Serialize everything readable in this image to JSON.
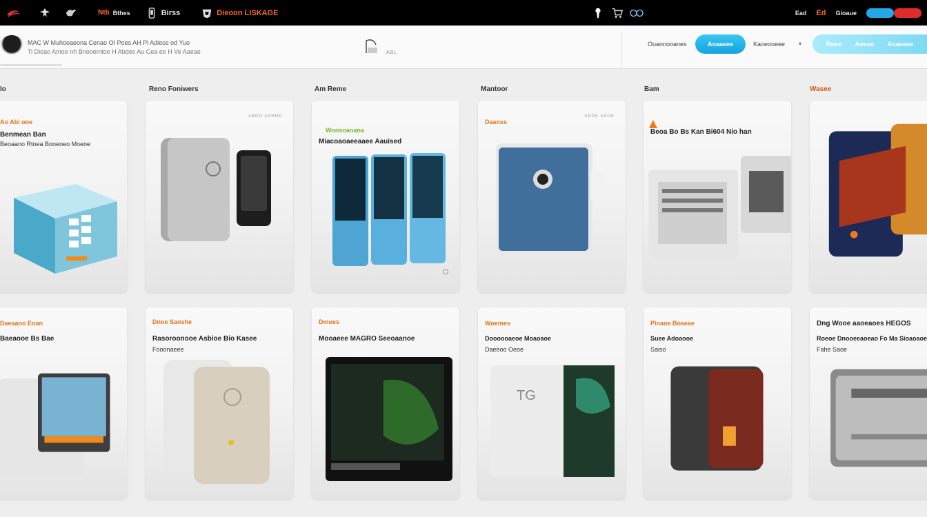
{
  "topbar": {
    "items": [
      {
        "label": "",
        "icon": "brand-logo"
      },
      {
        "label": "",
        "icon": "eagle-logo"
      },
      {
        "label": "Ntb",
        "icon": "bird-logo"
      },
      {
        "label": "Bthes",
        "icon": "partner-logo"
      },
      {
        "label": "Birss",
        "icon": "phone-icon"
      },
      {
        "label": "Dieoon LISKAGE",
        "icon": "badge-logo",
        "accent": true
      }
    ],
    "right": {
      "account_icon": "user-icon",
      "cart_icon": "cart-icon",
      "flag_label": "",
      "region_label": "Ead",
      "help_label": "Ed",
      "lang_label": "Gioaue",
      "toggle_icon": "toggle-switch"
    }
  },
  "header": {
    "tagline_1": "MAC W  Muhooaeona Cenao  OI Poes AH Pl Adiece od Yuo",
    "tagline_1_highlight": "",
    "tagline_2": "Ti Dioao Amoe nh  Bnooemtoe H Abdes Au Cea ee H Ve Aaeae",
    "center_mark": "ABL",
    "links": [
      "Ouannooanes",
      "Kaoeooeee"
    ],
    "primary_button": "Aoaaeee",
    "secondary_button": [
      "Roee",
      "Aoeoe",
      "Aoaeaoe"
    ]
  },
  "categories": [
    "Io",
    "Reno Foniwers",
    "Am Reme",
    "Mantoor",
    "Bam",
    "Wasee"
  ],
  "cards": [
    {
      "title": "Ao Abi ooe",
      "subtitle": "Benmean Ban",
      "line3": "Beoaano Rtoea  Booeoeo Moeoe",
      "accent": "orange"
    },
    {
      "title": "",
      "subtitle": "",
      "line3": "",
      "meta": "ABDO ASHNE"
    },
    {
      "title": "Wonsoanana",
      "subtitle": "Miacoaoaeeaaee Aauised",
      "line3": "",
      "accent": "green"
    },
    {
      "title": "Daanss",
      "subtitle": "",
      "line3": "",
      "meta": "ANDE ASOE",
      "accent": "orange"
    },
    {
      "title": "",
      "subtitle": "Beoa Bo Bs Kan Bi604 Nio han",
      "line3": "",
      "accent": "orange"
    },
    {
      "title": "",
      "subtitle": "",
      "line3": ""
    },
    {
      "title": "Daeaaoo Eoan",
      "subtitle": "Baeaooe Bs Bae",
      "line3": "",
      "accent": "orange"
    },
    {
      "title": "Dnoe  Saoshe",
      "subtitle": "Rasoroonooe Asbioe Bio Kasee",
      "line3": "Fooonaeee",
      "accent": "orange"
    },
    {
      "title": "Dmoes",
      "subtitle": "Mooaeee MAGRO Seeoaanoe",
      "line3": "",
      "accent": "orange"
    },
    {
      "title": "Woemes",
      "subtitle": "Doooooaeoe Moaoaoe",
      "line3": "Daeeoo Oeoe",
      "accent": "orange"
    },
    {
      "title": "Pinaoe Boaeae",
      "subtitle": "Suee Adoaooe",
      "line3": "Saiso",
      "accent": "orange"
    },
    {
      "title": "Dng Wooe  aaoeaoes HEGOS",
      "subtitle": "Roeoe Dnooeeaoeao  Fo Ma  Sioaoaoe",
      "line3": "Fahe Saoe",
      "accent": "orange"
    }
  ],
  "colors": {
    "topbar_bg": "#000000",
    "primary": "#1aa6e2",
    "accent_orange": "#e0741a",
    "accent_green": "#7db22a"
  }
}
